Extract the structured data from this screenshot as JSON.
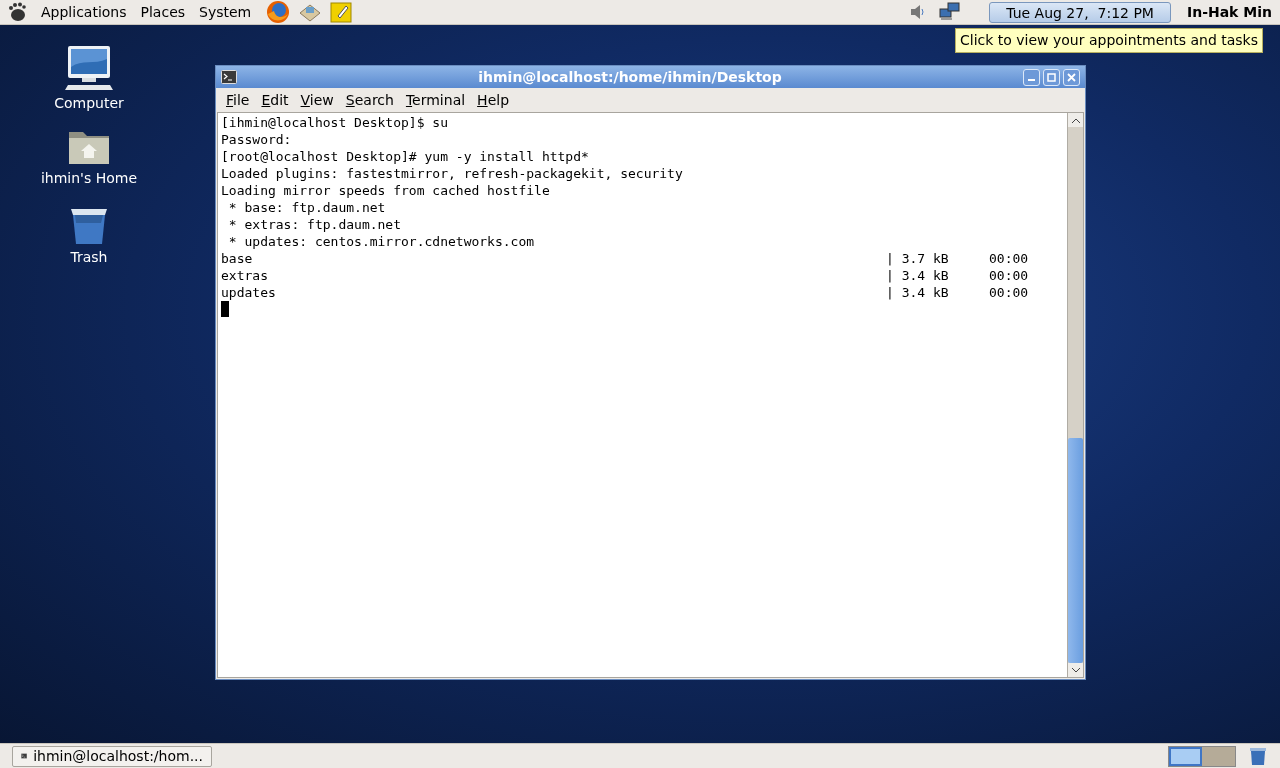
{
  "top_panel": {
    "menus": [
      "Applications",
      "Places",
      "System"
    ],
    "clock": "Tue Aug 27,  7:12 PM",
    "user": "In-Hak Min"
  },
  "tooltip": "Click to view your appointments and tasks",
  "desktop_icons": [
    {
      "kind": "computer",
      "label": "Computer"
    },
    {
      "kind": "home",
      "label": "ihmin's Home"
    },
    {
      "kind": "trash",
      "label": "Trash"
    }
  ],
  "terminal": {
    "title": "ihmin@localhost:/home/ihmin/Desktop",
    "menu": [
      "File",
      "Edit",
      "View",
      "Search",
      "Terminal",
      "Help"
    ],
    "lines": [
      {
        "kind": "text",
        "text": "[ihmin@localhost Desktop]$ su"
      },
      {
        "kind": "text",
        "text": "Password:"
      },
      {
        "kind": "text",
        "text": "[root@localhost Desktop]# yum -y install httpd*"
      },
      {
        "kind": "text",
        "text": "Loaded plugins: fastestmirror, refresh-packagekit, security"
      },
      {
        "kind": "text",
        "text": "Loading mirror speeds from cached hostfile"
      },
      {
        "kind": "text",
        "text": " * base: ftp.daum.net"
      },
      {
        "kind": "text",
        "text": " * extras: ftp.daum.net"
      },
      {
        "kind": "text",
        "text": " * updates: centos.mirror.cdnetworks.com"
      },
      {
        "kind": "repo",
        "name": "base",
        "size": "| 3.7 kB",
        "time": "00:00"
      },
      {
        "kind": "repo",
        "name": "extras",
        "size": "| 3.4 kB",
        "time": "00:00"
      },
      {
        "kind": "repo",
        "name": "updates",
        "size": "| 3.4 kB",
        "time": "00:00"
      }
    ]
  },
  "taskbar": {
    "tasks": [
      {
        "label": "ihmin@localhost:/hom...",
        "selected": false
      }
    ],
    "workspaces": [
      {
        "selected": true
      },
      {
        "selected": false
      }
    ]
  }
}
